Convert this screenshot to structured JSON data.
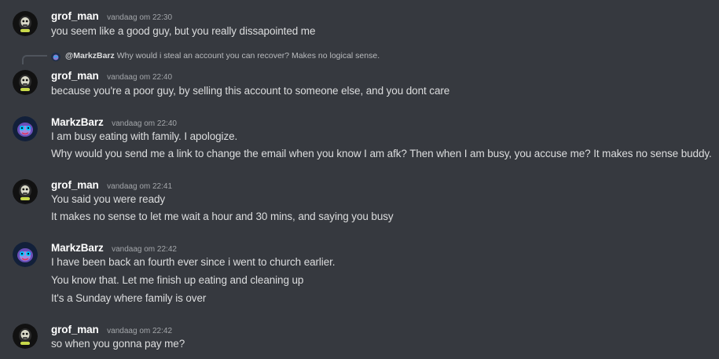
{
  "colors": {
    "background": "#36393f",
    "username": "#ffffff",
    "message_text": "#dcddde",
    "timestamp": "#a3a6aa"
  },
  "reply": {
    "mention": "@MarkzBarz",
    "text": "Why would i steal an account you can recover? Makes no logical sense.",
    "avatar_icon": "monkey-avatar-icon"
  },
  "messages": [
    {
      "username": "grof_man",
      "timestamp": "vandaag om 22:30",
      "avatar_icon": "skull-avatar-icon",
      "lines": [
        "you seem like a good guy, but you really dissapointed me"
      ]
    },
    {
      "username": "grof_man",
      "timestamp": "vandaag om 22:40",
      "avatar_icon": "skull-avatar-icon",
      "lines": [
        "because you're a poor guy, by selling this account to someone else, and you dont care"
      ]
    },
    {
      "username": "MarkzBarz",
      "timestamp": "vandaag om 22:40",
      "avatar_icon": "monkey-avatar-icon",
      "lines": [
        "I am busy eating with family. I apologize.",
        "Why would you send me a link to change the email when you know I am afk? Then when I am busy, you accuse me? It makes no sense buddy."
      ]
    },
    {
      "username": "grof_man",
      "timestamp": "vandaag om 22:41",
      "avatar_icon": "skull-avatar-icon",
      "lines": [
        "You said you were ready",
        "It makes no sense to let me wait a hour and 30 mins, and saying you busy"
      ]
    },
    {
      "username": "MarkzBarz",
      "timestamp": "vandaag om 22:42",
      "avatar_icon": "monkey-avatar-icon",
      "lines": [
        "I have been back an fourth ever since i went to church earlier.",
        "You know that. Let me finish up eating and cleaning up",
        "It's a Sunday where family is over"
      ]
    },
    {
      "username": "grof_man",
      "timestamp": "vandaag om 22:42",
      "avatar_icon": "skull-avatar-icon",
      "lines": [
        "so when you gonna pay me?"
      ]
    }
  ]
}
